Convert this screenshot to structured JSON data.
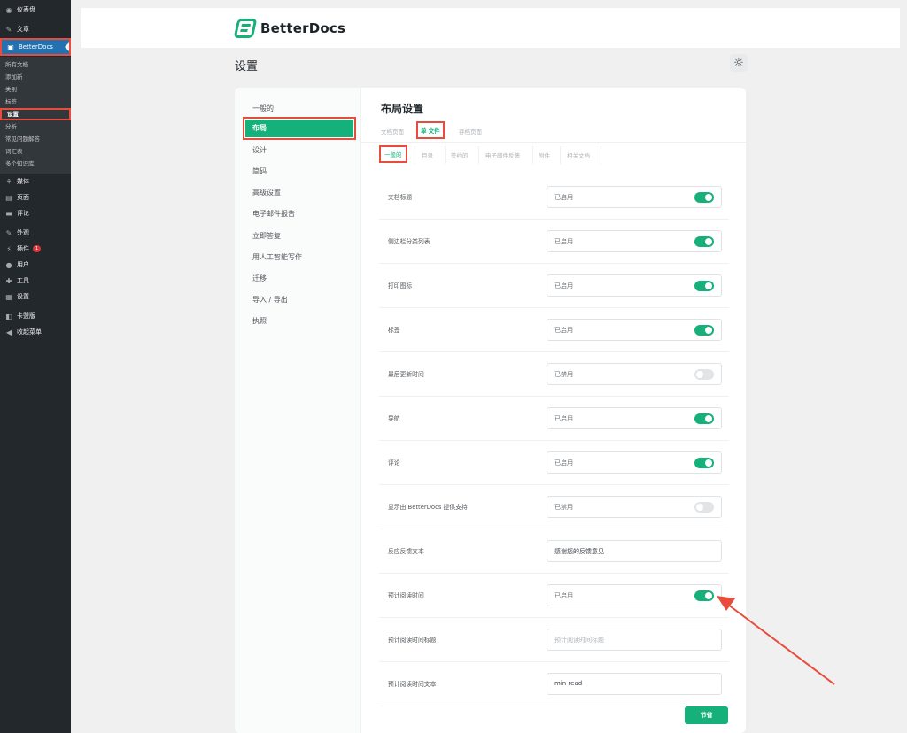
{
  "wp_menu": {
    "dashboard": "仪表盘",
    "posts": "文章",
    "betterdocs": "BetterDocs",
    "submenu": [
      "所有文档",
      "添加新",
      "类别",
      "标签",
      "设置",
      "分析",
      "常见问题解答",
      "词汇表",
      "多个知识库"
    ],
    "items_after": [
      {
        "icon": "media-icon",
        "label": "媒体",
        "glyph": "⚘"
      },
      {
        "icon": "pages-icon",
        "label": "页面",
        "glyph": "▤"
      },
      {
        "icon": "comments-icon",
        "label": "评论",
        "glyph": "▬"
      },
      {
        "icon": "appearance-icon",
        "label": "外观",
        "glyph": "✎"
      },
      {
        "icon": "plugins-icon",
        "label": "插件",
        "glyph": "⚡",
        "badge": "1"
      },
      {
        "icon": "users-icon",
        "label": "用户",
        "glyph": "●"
      },
      {
        "icon": "tools-icon",
        "label": "工具",
        "glyph": "✚"
      },
      {
        "icon": "settings-icon",
        "label": "设置",
        "glyph": "▦"
      },
      {
        "icon": "elementor-icon",
        "label": "卡盟版",
        "glyph": "◧"
      },
      {
        "icon": "collapse-icon",
        "label": "收起菜单",
        "glyph": "◀"
      }
    ]
  },
  "header": {
    "brand": "BetterDocs"
  },
  "page_title": "设置",
  "settings_nav": [
    "一般的",
    "布局",
    "设计",
    "简码",
    "高级设置",
    "电子邮件报告",
    "立即答复",
    "用人工智能写作",
    "迁移",
    "导入 / 导出",
    "执照"
  ],
  "content": {
    "title": "布局设置",
    "tabs": [
      "文档页面",
      "单  文件",
      "存档页面"
    ],
    "subtabs": [
      "一般的",
      "目录",
      "签约的",
      "电子邮件反馈",
      "附件",
      "相关文档"
    ],
    "rows": [
      {
        "label": "文档标题",
        "control": "已启用",
        "toggle": "on"
      },
      {
        "label": "侧边栏分类列表",
        "control": "已启用",
        "toggle": "on"
      },
      {
        "label": "打印图标",
        "control": "已启用",
        "toggle": "on"
      },
      {
        "label": "标签",
        "control": "已启用",
        "toggle": "on"
      },
      {
        "label": "最后更新时间",
        "control": "已禁用",
        "toggle": "off"
      },
      {
        "label": "导航",
        "control": "已启用",
        "toggle": "on"
      },
      {
        "label": "评论",
        "control": "已启用",
        "toggle": "on"
      },
      {
        "label": "显示由 BetterDocs 提供支持",
        "control": "已禁用",
        "toggle": "off"
      },
      {
        "label": "反应反馈文本",
        "control": "感谢您的反馈意见",
        "kind": "text"
      },
      {
        "label": "预计阅读时间",
        "control": "已启用",
        "toggle": "on"
      },
      {
        "label": "预计阅读时间标题",
        "control": "预计阅读时间标题",
        "kind": "placeholder"
      },
      {
        "label": "预计阅读时间文本",
        "control": "min read",
        "kind": "text"
      }
    ],
    "save_label": "节省"
  },
  "colors": {
    "accent": "#16b17a",
    "wp_sidebar": "#23282d",
    "wp_active": "#2271b1",
    "annotation": "#e74c3c"
  },
  "icons": {
    "theme_toggle": "sun-icon",
    "brand": "betterdocs-logo-icon"
  }
}
